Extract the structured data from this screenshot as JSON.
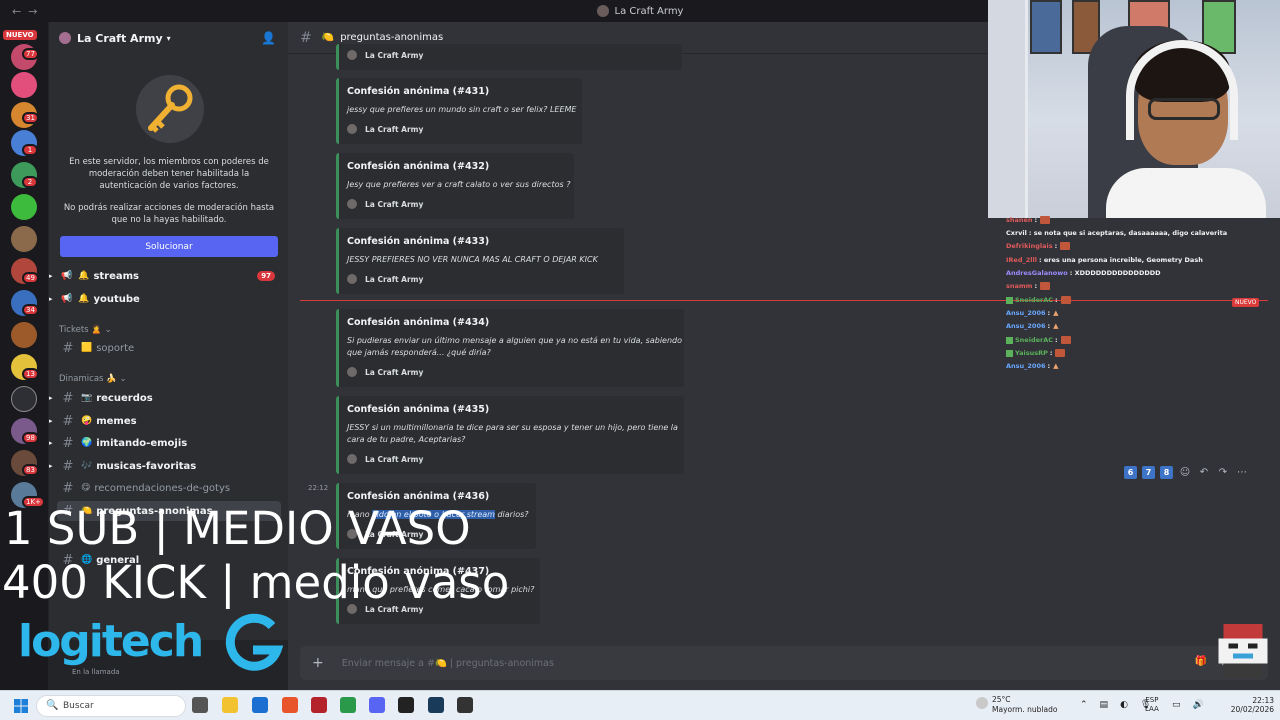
{
  "window": {
    "title": "La Craft Army"
  },
  "server_rail": {
    "nuevo_label": "NUEVO",
    "badges": [
      "77",
      "31",
      "1",
      "2",
      "49",
      "34",
      "13",
      "98",
      "83",
      "1K+"
    ]
  },
  "sidebar": {
    "server_name": "La Craft Army",
    "moderation_notice": "En este servidor, los miembros con poderes de moderación deben tener habilitada la autenticación de varios factores.",
    "moderation_notice_2": "No podrás realizar acciones de moderación hasta que no la hayas habilitado.",
    "solve_button": "Solucionar",
    "channels_top": [
      {
        "name": "streams",
        "count": "97"
      },
      {
        "name": "youtube"
      }
    ],
    "category_tickets": "Tickets",
    "tickets_channels": [
      {
        "name": "soporte"
      }
    ],
    "category_dinamicas": "Dinamicas",
    "dinamicas_channels": [
      {
        "name": "recuerdos"
      },
      {
        "name": "memes"
      },
      {
        "name": "imitando-emojis"
      },
      {
        "name": "musicas-favoritas"
      },
      {
        "name": "recomendaciones-de-gotys"
      },
      {
        "name": "preguntas-anonimas"
      },
      {
        "name": "general"
      }
    ],
    "user_status": "En la llamada"
  },
  "chat": {
    "channel_name": "preguntas-anonimas",
    "author": "La Craft Army",
    "time": "22:12",
    "confessions": [
      {
        "title": "Confesión anónima (#431)",
        "body": "jessy que prefieres un mundo sin craft o ser felix? LEEME"
      },
      {
        "title": "Confesión anónima (#432)",
        "body": "Jesy que prefieres ver a craft calato o ver sus directos ?"
      },
      {
        "title": "Confesión anónima (#433)",
        "body": "JESSY PREFIERES NO VER NUNCA MAS AL CRAFT O DEJAR KICK"
      },
      {
        "title": "Confesión anónima (#434)",
        "body": "Si pudieras enviar un último mensaje a alguien que ya no está en tu vida, sabiendo",
        "body2": "que jamás responderá... ¿qué diría?"
      },
      {
        "title": "Confesión anónima (#435)",
        "body": "JESSY si un multimillonaria te dice para ser su esposa y tener un hijo, pero tiene la",
        "body2": "cara de tu padre, Aceptarias?"
      },
      {
        "title": "Confesión anónima (#436)",
        "body_pre": "mano ",
        "body_hl": "lildo en el poto o hacer stream",
        "body_post": " diarios?"
      },
      {
        "title": "Confesión anónima (#437)",
        "body": "mano que prefieres comer caca o tomar pichi?"
      }
    ],
    "composer_placeholder": "Enviar mensaje a #🍋 | preguntas-anonimas",
    "hover_numbers": [
      "6",
      "7",
      "8"
    ]
  },
  "stream_chat": {
    "lines": [
      {
        "user": "shanen",
        "text": "",
        "emote": true,
        "color": "#e05a5a"
      },
      {
        "user": "Cxrvil",
        "text": "se nota que si aceptaras, dasaaaaaa, digo calaverita",
        "color": "#f2f3f5"
      },
      {
        "user": "Defrikinglais",
        "text": "",
        "emote": true,
        "color": "#e05a5a"
      },
      {
        "user": "IRed_2lll",
        "text": "eres una persona increible, Geometry Dash",
        "color": "#e05a5a"
      },
      {
        "user": "AndresGalanowo",
        "text": "XDDDDDDDDDDDDDDD",
        "color": "#9b8cff"
      },
      {
        "user": "snamm",
        "text": "",
        "emote": true,
        "color": "#e05a5a"
      },
      {
        "user": "SneiderAC",
        "text": "",
        "emote": true,
        "color": "#5bb25b",
        "mark": true
      },
      {
        "user": "Ansu_2006",
        "text": "",
        "fire": true,
        "color": "#6aa7ff"
      },
      {
        "user": "Ansu_2006",
        "text": "",
        "fire": true,
        "color": "#6aa7ff"
      },
      {
        "user": "SneiderAC",
        "text": "",
        "emote": true,
        "color": "#5bb25b",
        "mark": true
      },
      {
        "user": "YaisusRP",
        "text": "",
        "emote": true,
        "color": "#5bb25b",
        "mark": true
      },
      {
        "user": "Ansu_2006",
        "text": "",
        "fire": true,
        "color": "#6aa7ff"
      }
    ],
    "nuevo_label": "NUEVO"
  },
  "overlay_text": {
    "line1": "1 SUB | MEDIO VASO",
    "line2": "400 KICK | medio vaso",
    "logo": "logitech"
  },
  "taskbar": {
    "search_placeholder": "Buscar",
    "weather_temp": "25°C",
    "weather_desc": "Mayorm. nublado",
    "lang_top": "ESP",
    "lang_bottom": "LAA",
    "time": "22:13",
    "date": "20/02/2026"
  }
}
